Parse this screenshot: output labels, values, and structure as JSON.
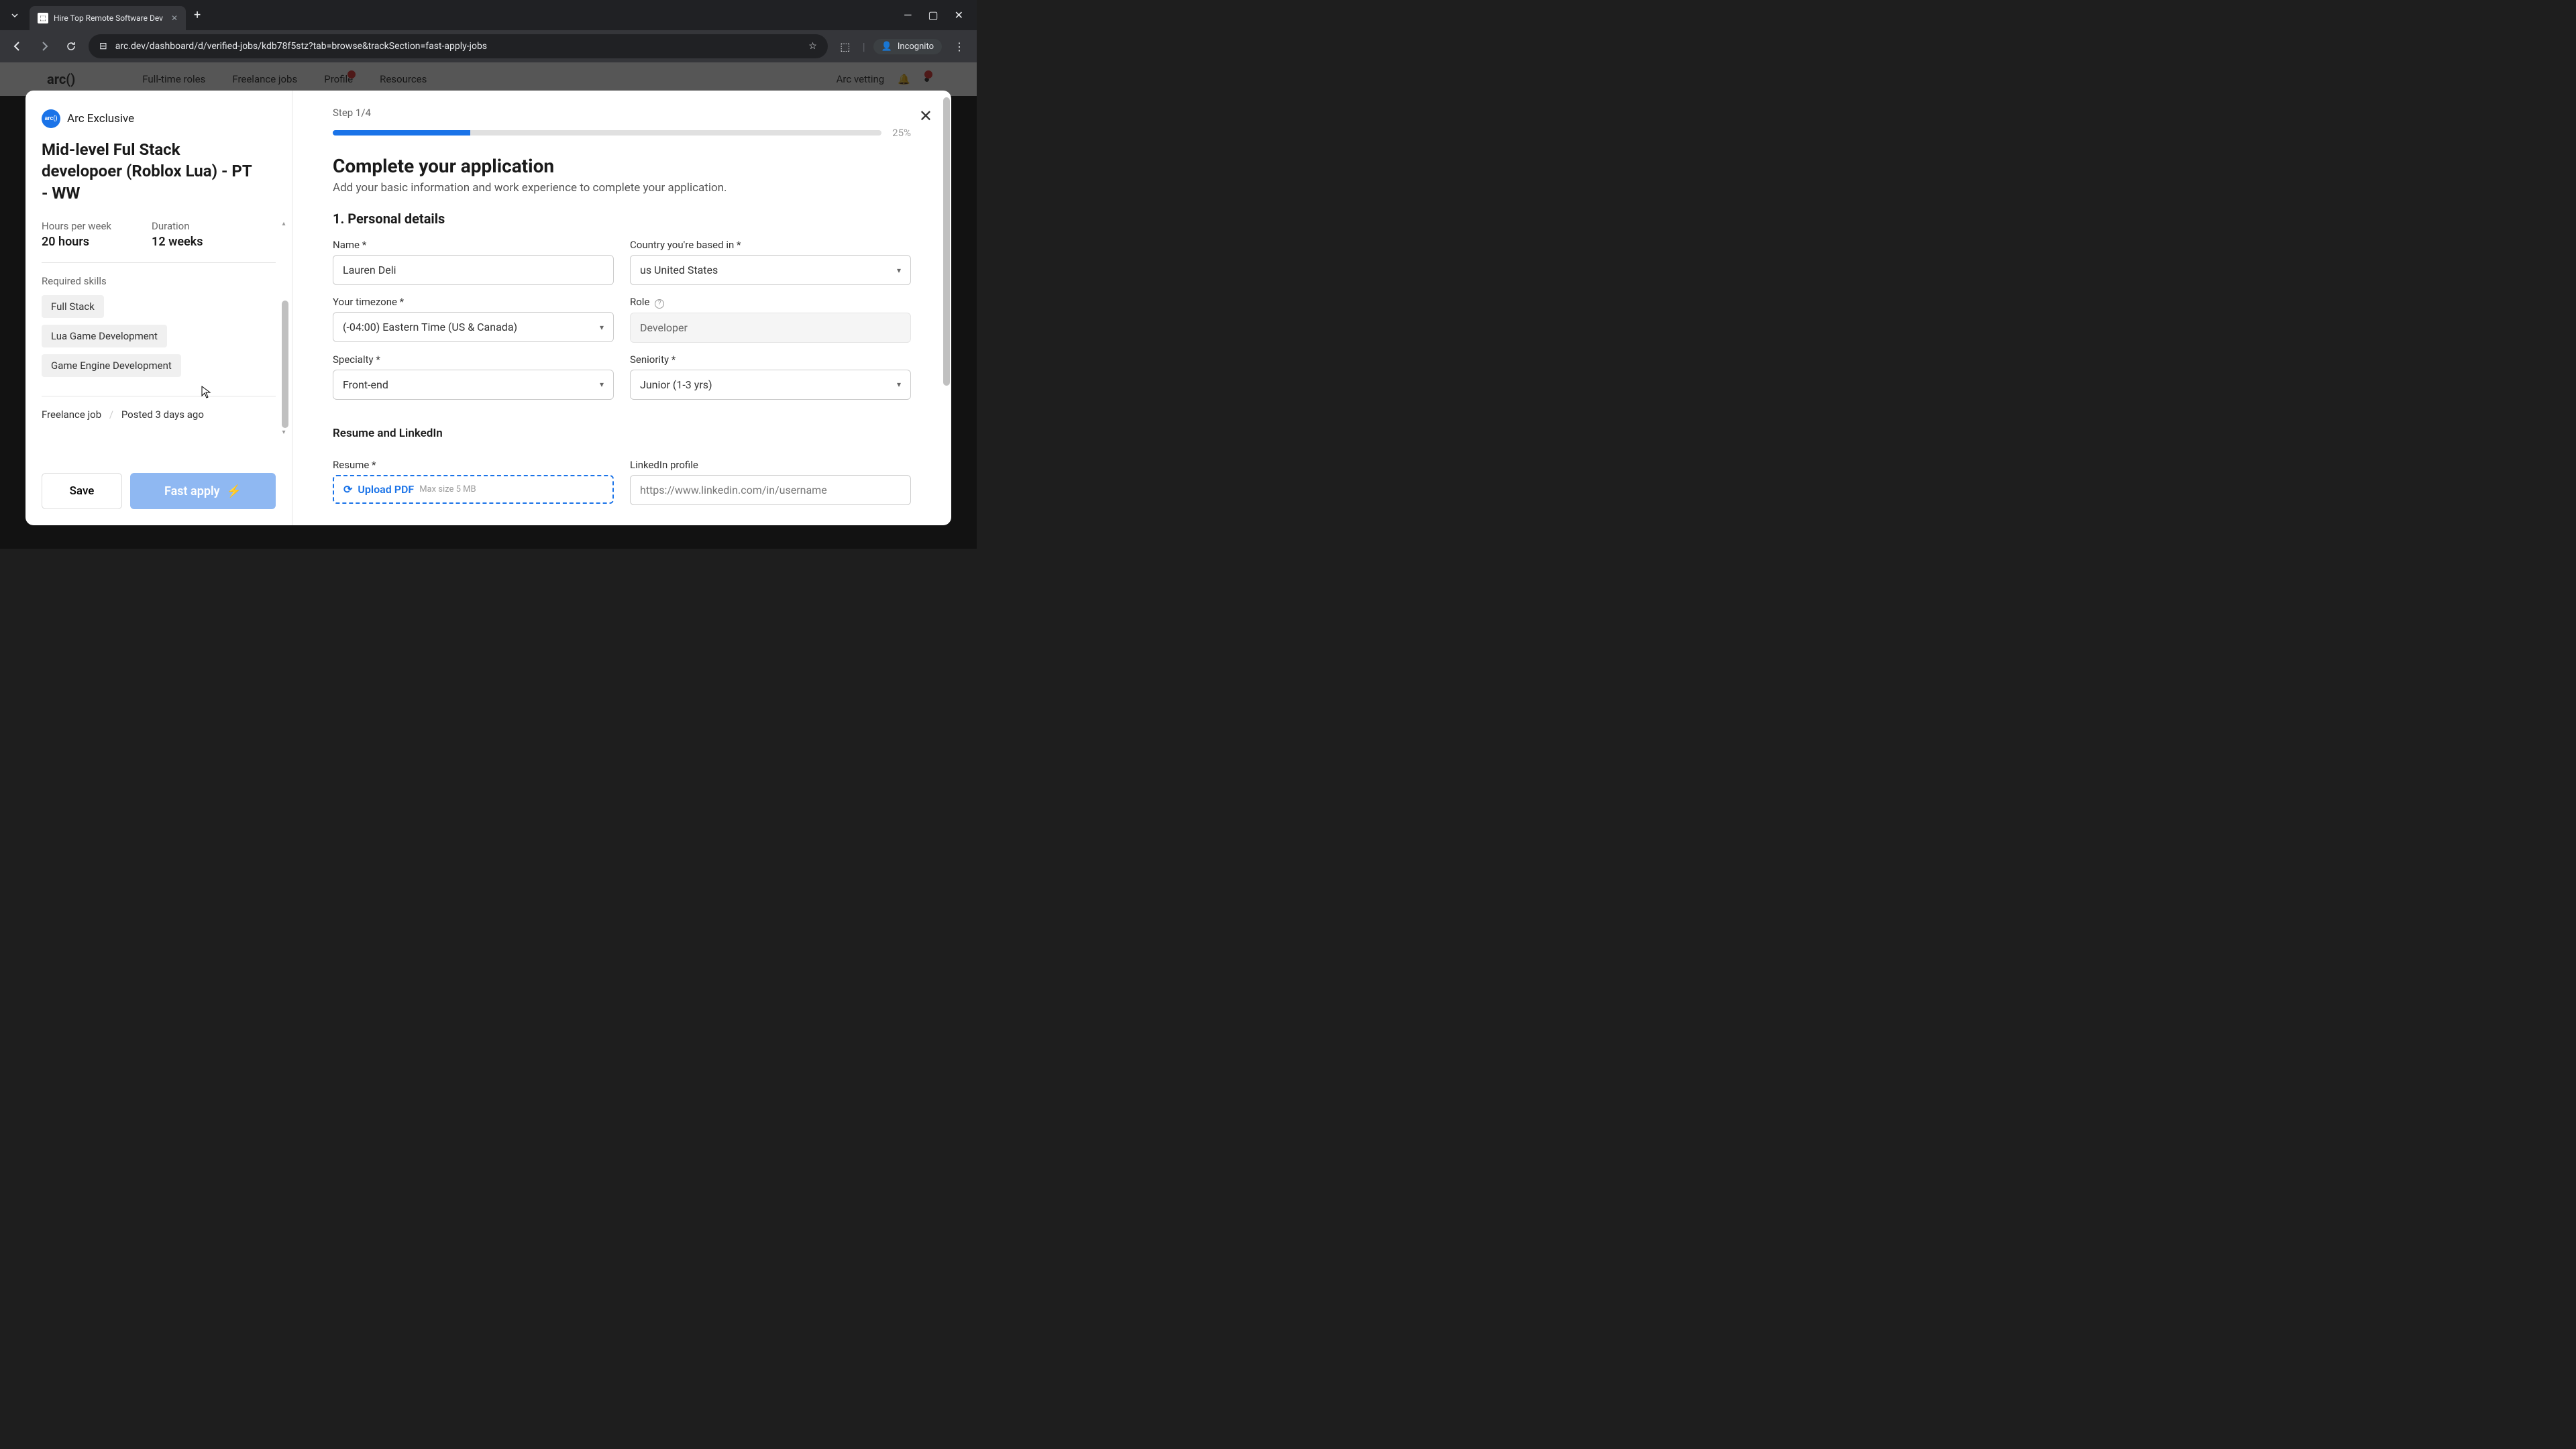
{
  "browser": {
    "tab_title": "Hire Top Remote Software Dev",
    "url": "arc.dev/dashboard/d/verified-jobs/kdb78f5stz?tab=browse&trackSection=fast-apply-jobs",
    "incognito_label": "Incognito"
  },
  "bg_nav": {
    "logo": "arc()",
    "items": [
      "Full-time roles",
      "Freelance jobs",
      "Profile",
      "Resources"
    ],
    "vetting": "Arc vetting"
  },
  "job": {
    "badge": "Arc Exclusive",
    "badge_icon": "arc()",
    "title": "Mid-level Ful Stack developoer (Roblox Lua) - PT - WW",
    "hours_label": "Hours per week",
    "hours_value": "20 hours",
    "duration_label": "Duration",
    "duration_value": "12 weeks",
    "skills_label": "Required skills",
    "skills": [
      "Full Stack",
      "Lua Game Development",
      "Game Engine Development"
    ],
    "type": "Freelance job",
    "posted": "Posted 3 days ago",
    "save_label": "Save",
    "apply_label": "Fast apply"
  },
  "form": {
    "step": "Step 1/4",
    "percent": "25%",
    "title": "Complete your application",
    "subtitle": "Add your basic information and work experience to complete your application.",
    "section1": "1. Personal details",
    "name_label": "Name *",
    "name_value": "Lauren Deli",
    "country_label": "Country you're based in *",
    "country_value": "us United States",
    "timezone_label": "Your timezone *",
    "timezone_value": "(-04:00) Eastern Time (US & Canada)",
    "role_label": "Role",
    "role_value": "Developer",
    "specialty_label": "Specialty *",
    "specialty_value": "Front-end",
    "seniority_label": "Seniority *",
    "seniority_value": "Junior (1-3 yrs)",
    "resume_section": "Resume and LinkedIn",
    "resume_label": "Resume *",
    "upload_label": "Upload PDF",
    "upload_hint": "Max size 5 MB",
    "linkedin_label": "LinkedIn profile",
    "linkedin_placeholder": "https://www.linkedin.com/in/username"
  }
}
